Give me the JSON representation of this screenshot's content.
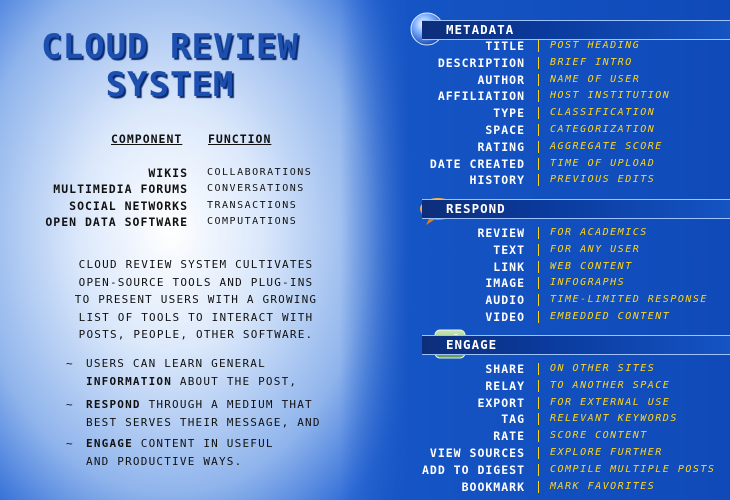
{
  "title_line1": "CLOUD REVIEW",
  "title_line2": "SYSTEM",
  "components_header": "COMPONENT",
  "function_header": "FUNCTION",
  "components": [
    {
      "name": "WIKIS",
      "function": "COLLABORATIONS"
    },
    {
      "name": "MULTIMEDIA FORUMS",
      "function": "CONVERSATIONS"
    },
    {
      "name": "SOCIAL NETWORKS",
      "function": "TRANSACTIONS"
    },
    {
      "name": "OPEN DATA SOFTWARE",
      "function": "COMPUTATIONS"
    }
  ],
  "paragraph": [
    "CLOUD REVIEW SYSTEM CULTIVATES",
    "OPEN-SOURCE TOOLS AND PLUG-INS",
    "TO PRESENT USERS WITH A GROWING",
    "LIST OF TOOLS TO INTERACT WITH",
    "POSTS, PEOPLE, OTHER SOFTWARE."
  ],
  "bullet_marker": "~",
  "bullets": [
    {
      "lines": [
        [
          "USERS CAN LEARN GENERAL",
          ""
        ],
        [
          "",
          "INFORMATION",
          " ABOUT THE POST,"
        ]
      ]
    },
    {
      "lines": [
        [
          "",
          "RESPOND",
          " THROUGH A MEDIUM THAT"
        ],
        [
          "BEST SERVES THEIR MESSAGE, AND",
          ""
        ]
      ]
    },
    {
      "lines": [
        [
          "",
          "ENGAGE",
          " CONTENT IN USEFUL"
        ],
        [
          "AND PRODUCTIVE WAYS.",
          ""
        ]
      ]
    }
  ],
  "sections": [
    {
      "title": "METADATA",
      "icon": "info-icon",
      "rows": [
        {
          "key": "TITLE",
          "value": "POST HEADING"
        },
        {
          "key": "DESCRIPTION",
          "value": "BRIEF INTRO"
        },
        {
          "key": "AUTHOR",
          "value": "NAME OF USER"
        },
        {
          "key": "AFFILIATION",
          "value": "HOST INSTITUTION"
        },
        {
          "key": "TYPE",
          "value": "CLASSIFICATION"
        },
        {
          "key": "SPACE",
          "value": "CATEGORIZATION"
        },
        {
          "key": "RATING",
          "value": "AGGREGATE SCORE"
        },
        {
          "key": "DATE CREATED",
          "value": "TIME OF UPLOAD"
        },
        {
          "key": "HISTORY",
          "value": "PREVIOUS EDITS"
        }
      ]
    },
    {
      "title": "RESPOND",
      "icon": "speech-bubble-icon",
      "rows": [
        {
          "key": "REVIEW",
          "value": "FOR ACADEMICS"
        },
        {
          "key": "TEXT",
          "value": "FOR ANY USER"
        },
        {
          "key": "LINK",
          "value": "WEB CONTENT"
        },
        {
          "key": "IMAGE",
          "value": "INFOGRAPHS"
        },
        {
          "key": "AUDIO",
          "value": "TIME-LIMITED RESPONSE"
        },
        {
          "key": "VIDEO",
          "value": "EMBEDDED CONTENT"
        }
      ]
    },
    {
      "title": "ENGAGE",
      "icon": "share-icon",
      "rows": [
        {
          "key": "SHARE",
          "value": "ON OTHER SITES"
        },
        {
          "key": "RELAY",
          "value": "TO ANOTHER SPACE"
        },
        {
          "key": "EXPORT",
          "value": "FOR EXTERNAL USE"
        },
        {
          "key": "TAG",
          "value": "RELEVANT KEYWORDS"
        },
        {
          "key": "RATE",
          "value": "SCORE CONTENT"
        },
        {
          "key": "VIEW SOURCES",
          "value": "EXPLORE FURTHER"
        },
        {
          "key": "ADD TO DIGEST",
          "value": "COMPILE MULTIPLE POSTS"
        },
        {
          "key": "BOOKMARK",
          "value": "MARK FAVORITES"
        }
      ]
    }
  ]
}
